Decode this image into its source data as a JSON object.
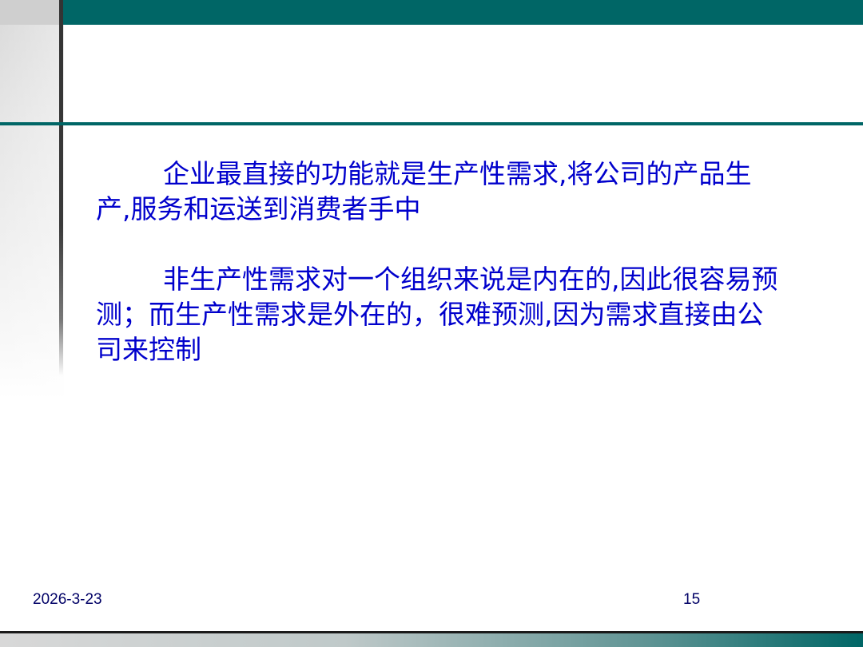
{
  "slide": {
    "title": "",
    "paragraphs": [
      "企业最直接的功能就是生产性需求,将公司的产品生产,服务和运送到消费者手中",
      "非生产性需求对一个组织来说是内在的,因此很容易预测；而生产性需求是外在的，很难预测,因为需求直接由公司来控制"
    ]
  },
  "footer": {
    "date": "2026-3-23",
    "page_number": "15"
  },
  "colors": {
    "accent": "#006666",
    "body_text": "#0000cc"
  }
}
